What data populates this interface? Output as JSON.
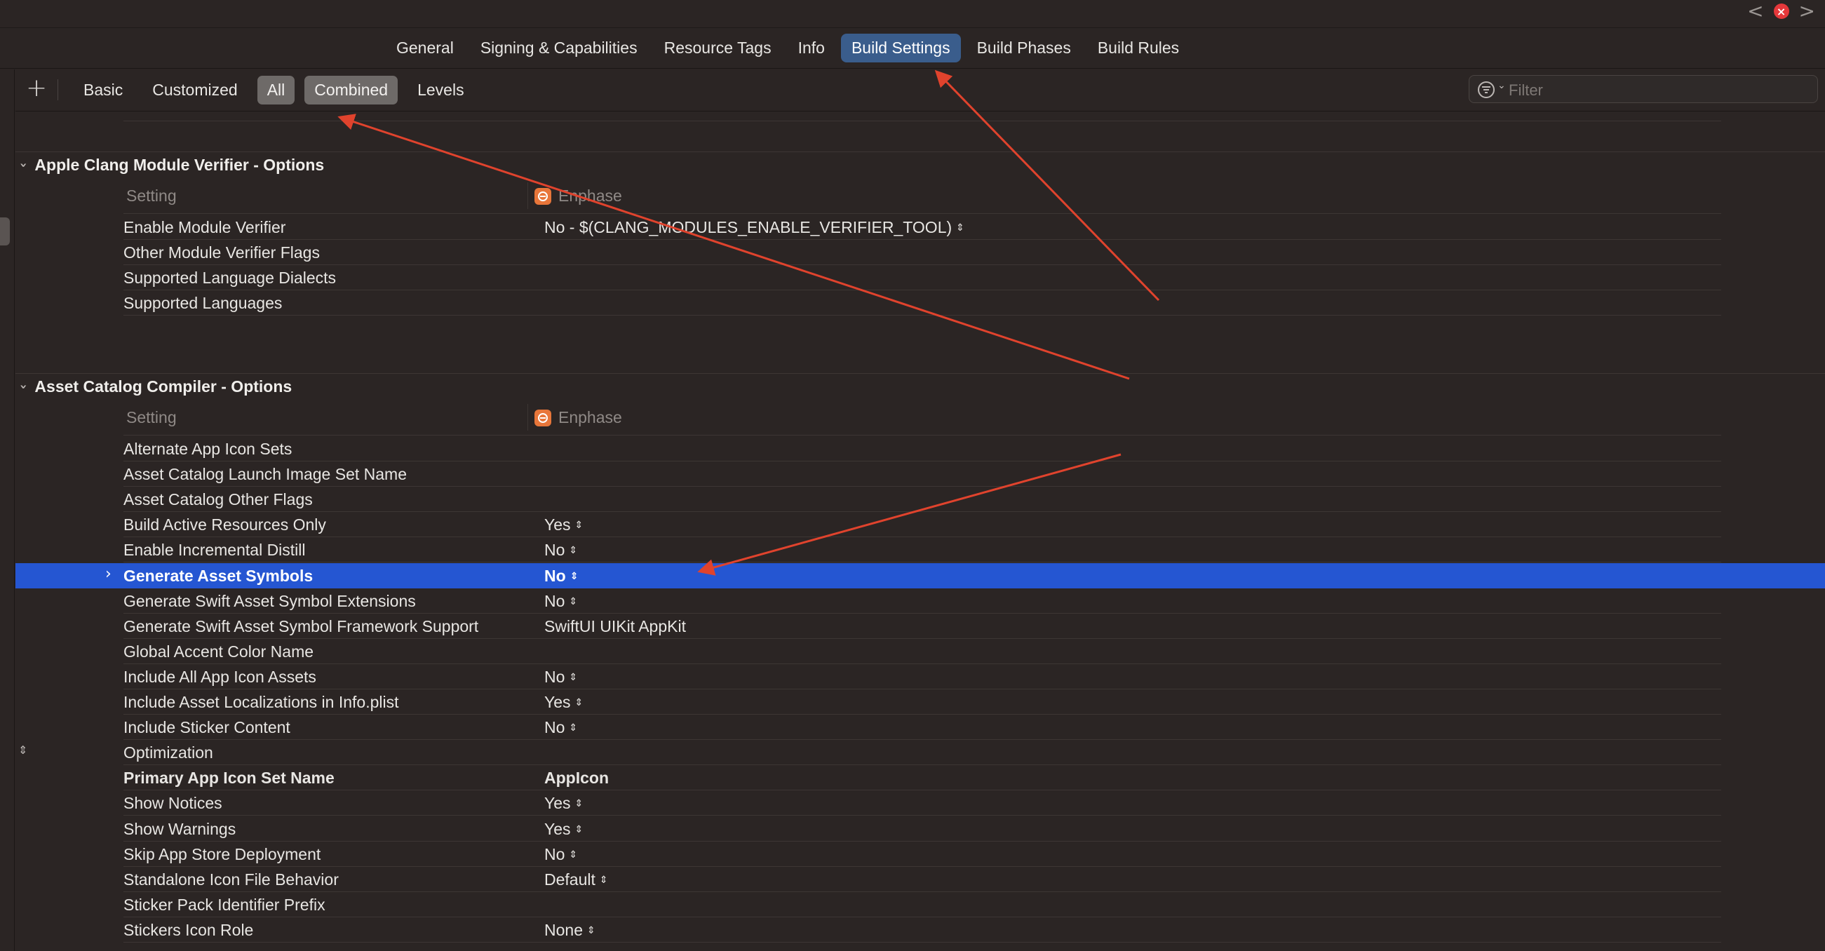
{
  "window": {
    "back_glyph": "<",
    "forward_glyph": ">",
    "close_glyph": "×"
  },
  "tabs": [
    {
      "label": "General",
      "active": false
    },
    {
      "label": "Signing & Capabilities",
      "active": false
    },
    {
      "label": "Resource Tags",
      "active": false
    },
    {
      "label": "Info",
      "active": false
    },
    {
      "label": "Build Settings",
      "active": true
    },
    {
      "label": "Build Phases",
      "active": false
    },
    {
      "label": "Build Rules",
      "active": false
    }
  ],
  "toolbar": {
    "add_glyph": "+",
    "segments": [
      {
        "label": "Basic",
        "on": false
      },
      {
        "label": "Customized",
        "on": false
      },
      {
        "label": "All",
        "on": true
      },
      {
        "label": "Combined",
        "on": true
      },
      {
        "label": "Levels",
        "on": false
      }
    ],
    "filter_placeholder": "Filter"
  },
  "sections": [
    {
      "title": "Apple Clang Module Verifier - Options",
      "column_setting": "Setting",
      "column_target": "Enphase",
      "rows": [
        {
          "name": "Enable Module Verifier",
          "value": "No  -  $(CLANG_MODULES_ENABLE_VERIFIER_TOOL)",
          "stepper": true
        },
        {
          "name": "Other Module Verifier Flags",
          "value": ""
        },
        {
          "name": "Supported Language Dialects",
          "value": ""
        },
        {
          "name": "Supported Languages",
          "value": ""
        }
      ]
    },
    {
      "title": "Asset Catalog Compiler - Options",
      "column_setting": "Setting",
      "column_target": "Enphase",
      "rows": [
        {
          "name": "Alternate App Icon Sets",
          "value": ""
        },
        {
          "name": "Asset Catalog Launch Image Set Name",
          "value": ""
        },
        {
          "name": "Asset Catalog Other Flags",
          "value": ""
        },
        {
          "name": "Build Active Resources Only",
          "value": "Yes",
          "stepper": true
        },
        {
          "name": "Enable Incremental Distill",
          "value": "No",
          "stepper": true
        },
        {
          "name": "Generate Asset Symbols",
          "value": "No",
          "stepper": true,
          "selected": true
        },
        {
          "name": "Generate Swift Asset Symbol Extensions",
          "value": "No",
          "stepper": true
        },
        {
          "name": "Generate Swift Asset Symbol Framework Support",
          "value": "SwiftUI UIKit AppKit"
        },
        {
          "name": "Global Accent Color Name",
          "value": ""
        },
        {
          "name": "Include All App Icon Assets",
          "value": "No",
          "stepper": true
        },
        {
          "name": "Include Asset Localizations in Info.plist",
          "value": "Yes",
          "stepper": true
        },
        {
          "name": "Include Sticker Content",
          "value": "No",
          "stepper": true
        },
        {
          "name": "Optimization",
          "value": ""
        },
        {
          "name": "Primary App Icon Set Name",
          "value": "AppIcon",
          "bold": true
        },
        {
          "name": "Show Notices",
          "value": "Yes",
          "stepper": true
        },
        {
          "name": "Show Warnings",
          "value": "Yes",
          "stepper": true
        },
        {
          "name": "Skip App Store Deployment",
          "value": "No",
          "stepper": true
        },
        {
          "name": "Standalone Icon File Behavior",
          "value": "Default",
          "stepper": true
        },
        {
          "name": "Sticker Pack Identifier Prefix",
          "value": ""
        },
        {
          "name": "Stickers Icon Role",
          "value": "None",
          "stepper": true
        }
      ]
    }
  ],
  "colors": {
    "background": "#2b2524",
    "selection": "#2556d2",
    "active_tab": "#3a5d8c",
    "annotation_arrow": "#e0432d",
    "target_icon": "#e8763a"
  }
}
